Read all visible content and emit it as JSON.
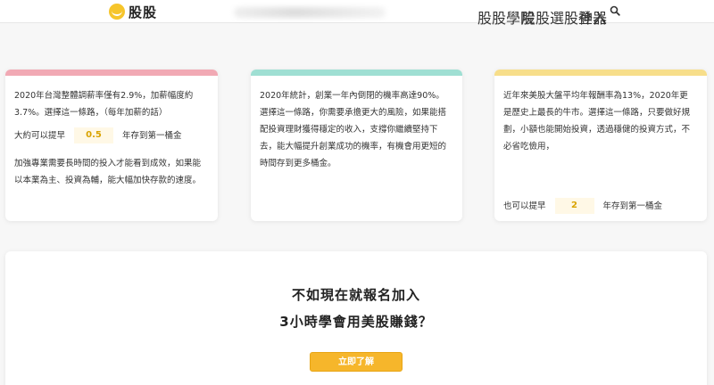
{
  "header": {
    "logo_text": "股股",
    "nav": [
      {
        "label": "股股學院"
      },
      {
        "label": "股股選股神器"
      },
      {
        "label": "登入"
      }
    ],
    "search_icon": "search-icon"
  },
  "cards": [
    {
      "accent": "#f1a9b4",
      "text1": "2020年台灣整體調薪率僅有2.9%，加薪幅度約3.7%。選擇這一條路，（每年加薪的話）",
      "year_prefix": "大約可以提早",
      "year_value": "0.5",
      "year_suffix": "年存到第一桶金",
      "text2": "加強專業需要長時間的投入才能看到成效，如果能以本業為主、投資為輔，能大幅加快存款的速度。"
    },
    {
      "accent": "#9fdfd3",
      "text1": "2020年統計，創業一年內倒閉的機率高達90%。選擇這一條路，你需要承擔更大的風險，如果能搭配投資理財獲得穩定的收入，支撐你繼續堅持下去，能大幅提升創業成功的機率，有機會用更短的時間存到更多桶金。"
    },
    {
      "accent": "#f7de8a",
      "text1": "近年來美股大盤平均年報酬率為13%，2020年更是歷史上最長的牛市。選擇這一條路，只要做好規劃，小額也能開始投資，透過穩健的投資方式，不必省吃儉用，",
      "year_prefix": "也可以提早",
      "year_value": "2",
      "year_suffix": "年存到第一桶金"
    }
  ],
  "cta": {
    "line1": "不如現在就報名加入",
    "line2": "3小時學會用美股賺錢？",
    "button": "立即了解"
  }
}
